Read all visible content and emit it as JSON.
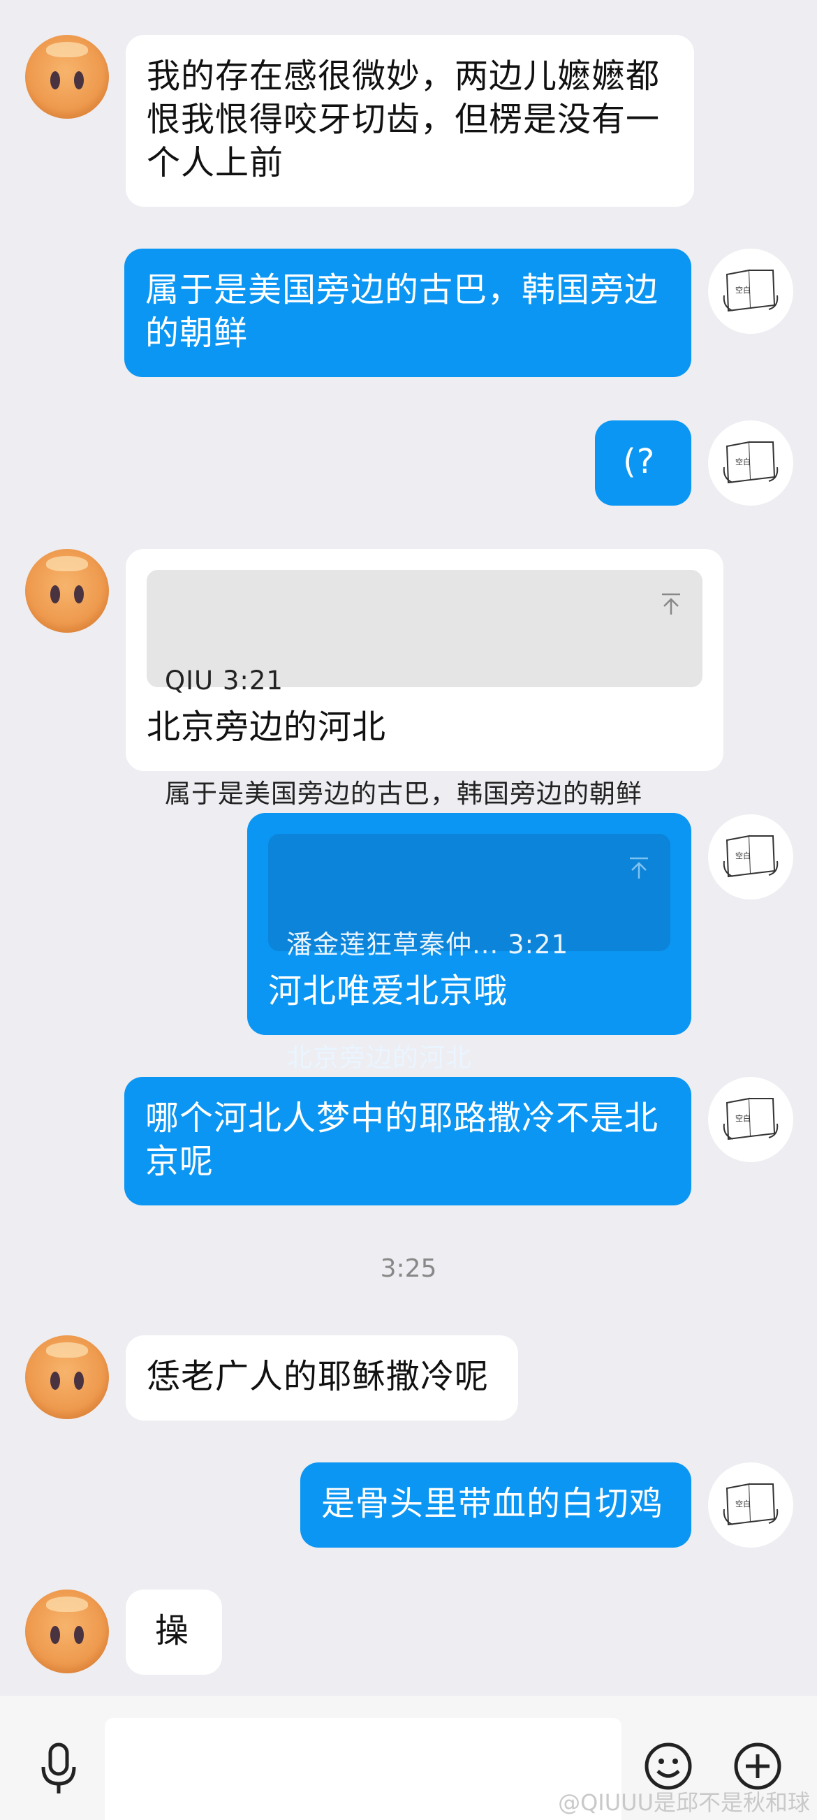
{
  "messages": [
    {
      "side": "in",
      "text": "我的存在感很微妙，两边儿嬷嬷都\n恨我恨得咬牙切齿，但楞是没有一\n个人上前"
    },
    {
      "side": "out",
      "text": "属于是美国旁边的古巴，韩国旁边\n的朝鲜"
    },
    {
      "side": "out",
      "text": "(?"
    },
    {
      "side": "in",
      "quote": {
        "author_time": "QIU 3:21",
        "text": "属于是美国旁边的古巴，韩国旁边的朝鲜"
      },
      "text": "北京旁边的河北"
    },
    {
      "side": "out",
      "quote": {
        "author_time": "潘金莲狂草秦仲... 3:21",
        "text": "北京旁边的河北"
      },
      "text": "河北唯爱北京哦"
    },
    {
      "side": "out",
      "text": "哪个河北人梦中的耶路撒冷不是北\n京呢"
    },
    {
      "side": "in",
      "text": "恁老广人的耶稣撒冷呢"
    },
    {
      "side": "out",
      "text": "是骨头里带血的白切鸡"
    },
    {
      "side": "in",
      "text": "操"
    }
  ],
  "timestamp": "3:25",
  "input_bar": {
    "voice_icon": "microphone-icon",
    "emoji_icon": "smiley-icon",
    "plus_icon": "plus-circle-icon"
  },
  "avatar_right_label": "空白",
  "watermark": "@QIUUU是邱不是秋和球",
  "colors": {
    "background": "#EDEDF2",
    "outgoing": "#0A96F2",
    "incoming": "#FFFFFF"
  }
}
